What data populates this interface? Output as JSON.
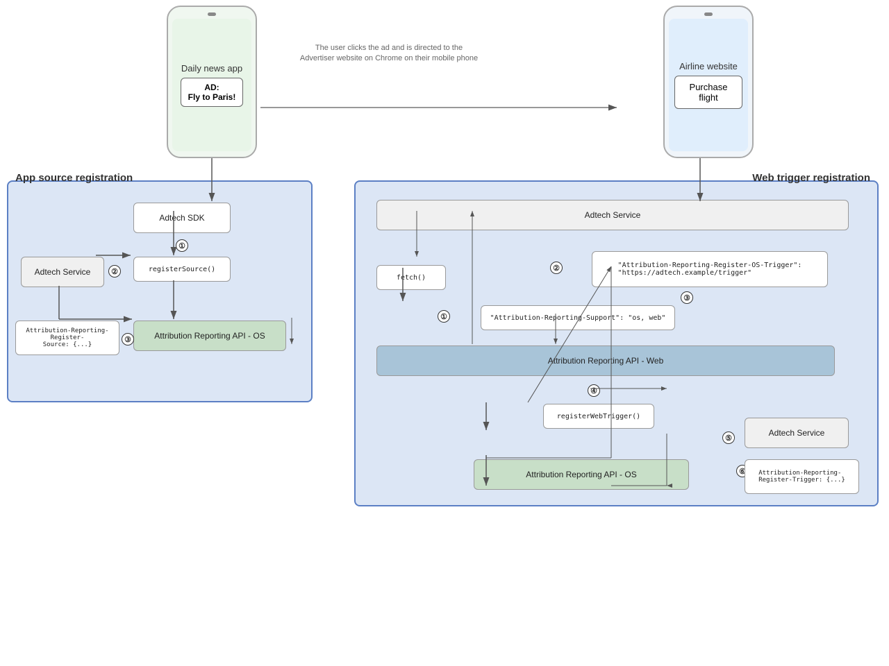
{
  "phones": {
    "left": {
      "title": "Daily news app",
      "ad_label": "AD:",
      "ad_text": "Fly to Paris!"
    },
    "right": {
      "title": "Airline website",
      "button": "Purchase flight"
    }
  },
  "caption": "The user clicks the ad and is directed to\nthe Advertiser website on Chrome on\ntheir mobile phone",
  "app_source": {
    "title": "App source registration",
    "nodes": {
      "adtech_sdk": "Adtech SDK",
      "adtech_service": "Adtech Service",
      "register_source": "registerSource()",
      "attribution_os": "Attribution Reporting API - OS",
      "attr_header": "Attribution-Reporting-Register-\nSource: {...}"
    },
    "steps": [
      "①",
      "②",
      "③"
    ]
  },
  "web_trigger": {
    "title": "Web trigger registration",
    "nodes": {
      "adtech_service_top": "Adtech Service",
      "fetch": "fetch()",
      "os_trigger_header": "\"Attribution-Reporting-Register-OS-Trigger\":\n\"https://adtech.example/trigger\"",
      "support_header": "\"Attribution-Reporting-Support\": \"os, web\"",
      "attribution_web": "Attribution Reporting API - Web",
      "register_web_trigger": "registerWebTrigger()",
      "adtech_service_right": "Adtech Service",
      "attribution_os": "Attribution Reporting API - OS",
      "attr_trigger_header": "Attribution-Reporting-\nRegister-Trigger: {...}"
    },
    "steps": [
      "①",
      "②",
      "③",
      "④",
      "⑤",
      "⑥"
    ]
  }
}
